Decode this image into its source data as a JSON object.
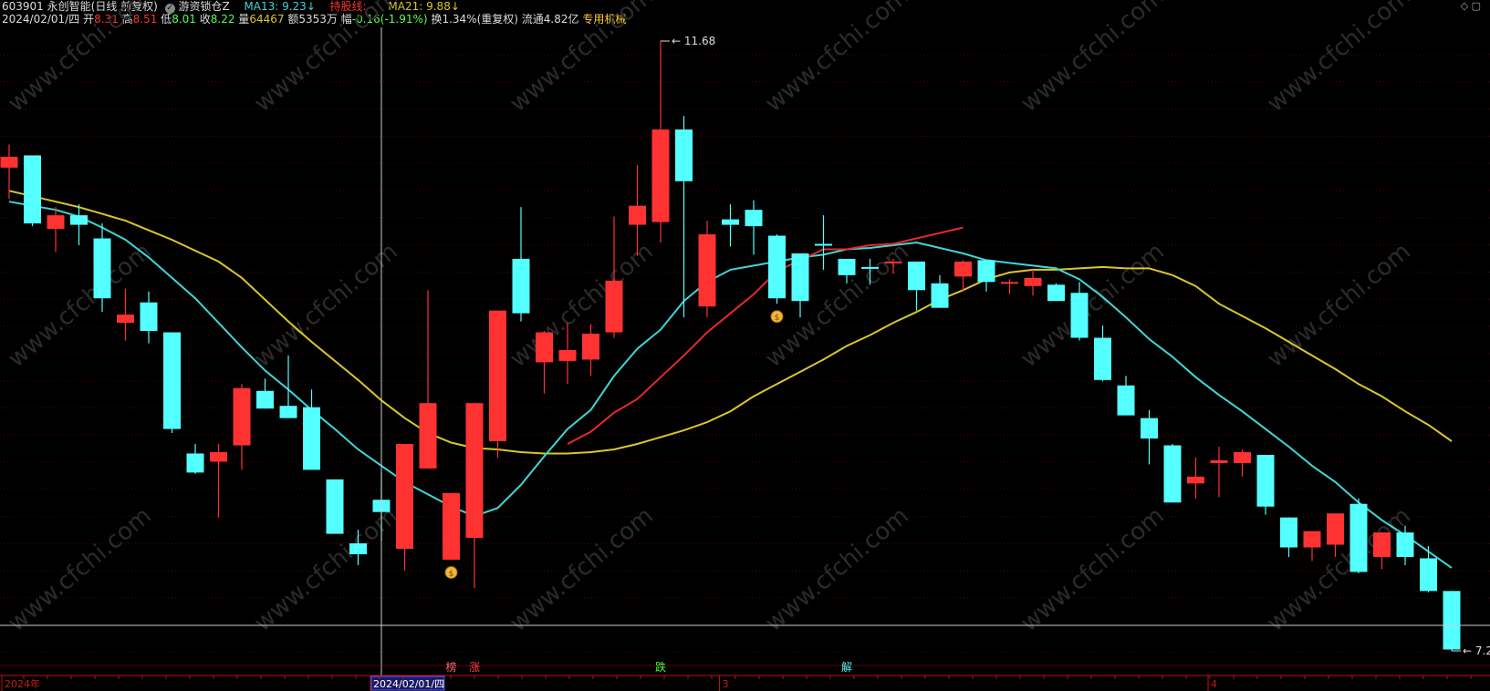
{
  "header": {
    "code": "603901",
    "name": "永创智能",
    "period": "(日线 前复权)",
    "indicator_name": "游资锁仓Z",
    "ma13_label": "MA13:",
    "ma13_value": "9.23",
    "ma13_arrow": "↓",
    "hold_label": "持股线:",
    "hold_value": "-",
    "ma21_label": "MA21:",
    "ma21_value": "9.88",
    "ma21_arrow": "↓",
    "date": "2024/02/01/四",
    "open_label": "开",
    "open_value": "8.31",
    "high_label": "高",
    "high_value": "8.51",
    "low_label": "低",
    "low_value": "8.01",
    "close_label": "收",
    "close_value": "8.22",
    "volume_label": "量",
    "volume_value": "64467",
    "amount_label": "额",
    "amount_value": "5353万",
    "change_label": "幅",
    "change_value": "-0.16(-1.91%)",
    "turnover_label": "换",
    "turnover_value": "1.34%(重复权)",
    "float_label": "流通",
    "float_value": "4.82亿",
    "sector": "专用机械"
  },
  "icons": {
    "indicator": "check-circle-icon",
    "top_right": "diamond-icon"
  },
  "colors": {
    "up": "#ff3232",
    "down": "#54ffff",
    "ma13": "#3fd6d6",
    "ma21": "#d9c72c",
    "hold": "#e8292c",
    "grid": "#5a0000",
    "axis": "#c01010"
  },
  "chart_data": {
    "type": "candlestick",
    "title": "",
    "ylim": [
      7.0,
      12.0
    ],
    "candles": [
      {
        "o": 10.75,
        "h": 10.92,
        "l": 10.52,
        "c": 10.83
      },
      {
        "o": 10.84,
        "h": 10.84,
        "l": 10.32,
        "c": 10.34
      },
      {
        "o": 10.3,
        "h": 10.46,
        "l": 10.13,
        "c": 10.4
      },
      {
        "o": 10.4,
        "h": 10.48,
        "l": 10.18,
        "c": 10.33
      },
      {
        "o": 10.23,
        "h": 10.34,
        "l": 9.69,
        "c": 9.79
      },
      {
        "o": 9.61,
        "h": 9.86,
        "l": 9.48,
        "c": 9.67
      },
      {
        "o": 9.76,
        "h": 9.84,
        "l": 9.46,
        "c": 9.55
      },
      {
        "o": 9.54,
        "h": 9.54,
        "l": 8.8,
        "c": 8.83
      },
      {
        "o": 8.65,
        "h": 8.72,
        "l": 8.5,
        "c": 8.51
      },
      {
        "o": 8.59,
        "h": 8.72,
        "l": 8.18,
        "c": 8.66
      },
      {
        "o": 8.71,
        "h": 9.16,
        "l": 8.53,
        "c": 9.13
      },
      {
        "o": 9.11,
        "h": 9.2,
        "l": 8.98,
        "c": 8.98
      },
      {
        "o": 9.0,
        "h": 9.37,
        "l": 8.91,
        "c": 8.91
      },
      {
        "o": 8.99,
        "h": 9.12,
        "l": 8.53,
        "c": 8.53
      },
      {
        "o": 8.46,
        "h": 8.46,
        "l": 8.07,
        "c": 8.06
      },
      {
        "o": 7.99,
        "h": 8.09,
        "l": 7.83,
        "c": 7.91
      },
      {
        "o": 8.31,
        "h": 8.51,
        "l": 8.01,
        "c": 8.22
      },
      {
        "o": 7.95,
        "h": 8.72,
        "l": 7.79,
        "c": 8.72
      },
      {
        "o": 8.54,
        "h": 9.85,
        "l": 8.54,
        "c": 9.02
      },
      {
        "o": 7.87,
        "h": 8.36,
        "l": 7.87,
        "c": 8.36
      },
      {
        "o": 8.03,
        "h": 9.02,
        "l": 7.66,
        "c": 9.02
      },
      {
        "o": 8.74,
        "h": 9.7,
        "l": 8.62,
        "c": 9.7
      },
      {
        "o": 10.08,
        "h": 10.46,
        "l": 9.62,
        "c": 9.68
      },
      {
        "o": 9.32,
        "h": 9.55,
        "l": 9.09,
        "c": 9.54
      },
      {
        "o": 9.33,
        "h": 9.61,
        "l": 9.16,
        "c": 9.41
      },
      {
        "o": 9.34,
        "h": 9.6,
        "l": 9.22,
        "c": 9.53
      },
      {
        "o": 9.54,
        "h": 10.39,
        "l": 9.5,
        "c": 9.92
      },
      {
        "o": 10.33,
        "h": 10.77,
        "l": 10.1,
        "c": 10.47
      },
      {
        "o": 10.35,
        "h": 11.68,
        "l": 10.2,
        "c": 11.03
      },
      {
        "o": 11.03,
        "h": 11.13,
        "l": 9.65,
        "c": 10.65
      },
      {
        "o": 9.73,
        "h": 10.36,
        "l": 9.65,
        "c": 10.26
      },
      {
        "o": 10.37,
        "h": 10.48,
        "l": 10.17,
        "c": 10.33
      },
      {
        "o": 10.44,
        "h": 10.51,
        "l": 10.11,
        "c": 10.32
      },
      {
        "o": 10.25,
        "h": 10.26,
        "l": 9.75,
        "c": 9.79
      },
      {
        "o": 10.12,
        "h": 10.12,
        "l": 9.65,
        "c": 9.77
      },
      {
        "o": 10.19,
        "h": 10.4,
        "l": 10.0,
        "c": 10.18
      },
      {
        "o": 10.08,
        "h": 10.08,
        "l": 9.9,
        "c": 9.96
      },
      {
        "o": 10.02,
        "h": 10.08,
        "l": 9.89,
        "c": 10.01
      },
      {
        "o": 10.05,
        "h": 10.08,
        "l": 9.97,
        "c": 10.06
      },
      {
        "o": 10.06,
        "h": 10.06,
        "l": 9.7,
        "c": 9.85
      },
      {
        "o": 9.9,
        "h": 9.96,
        "l": 9.72,
        "c": 9.72
      },
      {
        "o": 9.95,
        "h": 10.07,
        "l": 9.84,
        "c": 10.06
      },
      {
        "o": 10.07,
        "h": 10.07,
        "l": 9.84,
        "c": 9.91
      },
      {
        "o": 9.91,
        "h": 9.93,
        "l": 9.82,
        "c": 9.91
      },
      {
        "o": 9.88,
        "h": 10.0,
        "l": 9.81,
        "c": 9.94
      },
      {
        "o": 9.89,
        "h": 9.9,
        "l": 9.77,
        "c": 9.77
      },
      {
        "o": 9.83,
        "h": 9.91,
        "l": 9.48,
        "c": 9.5
      },
      {
        "o": 9.5,
        "h": 9.59,
        "l": 9.18,
        "c": 9.19
      },
      {
        "o": 9.15,
        "h": 9.22,
        "l": 8.93,
        "c": 8.93
      },
      {
        "o": 8.91,
        "h": 8.97,
        "l": 8.57,
        "c": 8.76
      },
      {
        "o": 8.71,
        "h": 8.72,
        "l": 8.29,
        "c": 8.29
      },
      {
        "o": 8.43,
        "h": 8.62,
        "l": 8.32,
        "c": 8.48
      },
      {
        "o": 8.58,
        "h": 8.7,
        "l": 8.33,
        "c": 8.6
      },
      {
        "o": 8.58,
        "h": 8.68,
        "l": 8.48,
        "c": 8.66
      },
      {
        "o": 8.64,
        "h": 8.64,
        "l": 8.2,
        "c": 8.26
      },
      {
        "o": 8.18,
        "h": 8.18,
        "l": 7.89,
        "c": 7.96
      },
      {
        "o": 7.96,
        "h": 8.03,
        "l": 7.86,
        "c": 8.08
      },
      {
        "o": 7.98,
        "h": 8.1,
        "l": 7.89,
        "c": 8.21
      },
      {
        "o": 8.28,
        "h": 8.32,
        "l": 7.77,
        "c": 7.78
      },
      {
        "o": 7.89,
        "h": 8.07,
        "l": 7.8,
        "c": 8.07
      },
      {
        "o": 8.07,
        "h": 8.12,
        "l": 7.83,
        "c": 7.89
      },
      {
        "o": 7.88,
        "h": 7.97,
        "l": 7.63,
        "c": 7.64
      },
      {
        "o": 7.64,
        "h": 7.64,
        "l": 7.2,
        "c": 7.21
      }
    ],
    "ma13": [
      10.5,
      10.47,
      10.44,
      10.39,
      10.31,
      10.22,
      10.09,
      9.94,
      9.79,
      9.61,
      9.43,
      9.26,
      9.12,
      8.97,
      8.83,
      8.68,
      8.56,
      8.44,
      8.35,
      8.26,
      8.19,
      8.25,
      8.42,
      8.63,
      8.83,
      8.97,
      9.22,
      9.42,
      9.56,
      9.77,
      9.91,
      10.0,
      10.03,
      10.06,
      10.09,
      10.11,
      10.15,
      10.16,
      10.18,
      10.2,
      10.16,
      10.12,
      10.07,
      10.05,
      10.03,
      10.01,
      9.93,
      9.8,
      9.65,
      9.49,
      9.36,
      9.21,
      9.08,
      8.96,
      8.83,
      8.7,
      8.56,
      8.44,
      8.29,
      8.16,
      8.05,
      7.93,
      7.81
    ],
    "ma21": [
      10.58,
      10.54,
      10.5,
      10.46,
      10.41,
      10.36,
      10.29,
      10.22,
      10.14,
      10.06,
      9.94,
      9.78,
      9.62,
      9.47,
      9.33,
      9.19,
      9.04,
      8.91,
      8.8,
      8.73,
      8.69,
      8.68,
      8.66,
      8.65,
      8.65,
      8.66,
      8.68,
      8.72,
      8.77,
      8.82,
      8.88,
      8.96,
      9.07,
      9.16,
      9.25,
      9.34,
      9.44,
      9.52,
      9.61,
      9.69,
      9.78,
      9.85,
      9.93,
      9.98,
      10.0,
      10.0,
      10.01,
      10.02,
      10.01,
      10.01,
      9.96,
      9.88,
      9.75,
      9.66,
      9.57,
      9.47,
      9.37,
      9.27,
      9.16,
      9.07,
      8.96,
      8.86,
      8.74
    ],
    "hold_line": [
      null,
      null,
      null,
      null,
      null,
      null,
      null,
      null,
      null,
      null,
      null,
      null,
      null,
      null,
      null,
      null,
      null,
      null,
      null,
      null,
      null,
      null,
      null,
      null,
      8.72,
      8.81,
      8.95,
      9.05,
      9.21,
      9.37,
      9.54,
      9.68,
      9.82,
      9.99,
      10.07,
      10.15,
      10.15,
      10.18,
      10.19,
      10.23,
      10.27,
      10.31,
      null,
      null,
      null,
      null,
      null,
      null,
      null,
      null,
      null,
      null,
      null,
      null,
      null,
      null,
      null,
      null,
      null,
      null,
      null,
      null,
      null
    ],
    "high_mark": {
      "index": 28,
      "value": "11.68"
    },
    "low_mark": {
      "index": 62,
      "value": "7.20"
    },
    "crosshair": {
      "index": 16
    },
    "signals": [
      {
        "index": 19,
        "text": "榜",
        "color": "#ff7070"
      },
      {
        "index": 20,
        "text": "涨",
        "color": "#ff4040"
      },
      {
        "index": 28,
        "text": "跌",
        "color": "#40ff40"
      },
      {
        "index": 36,
        "text": "解",
        "color": "#54ffff"
      }
    ],
    "money_bags": [
      19,
      33
    ],
    "x_axis": [
      {
        "index": 0,
        "label": "2024年"
      },
      {
        "index": 16,
        "label": "2024/02/01/四",
        "highlight": true
      },
      {
        "index": 31,
        "label": "3"
      },
      {
        "index": 52,
        "label": "4"
      }
    ],
    "watermark": "www.cfchi.com"
  }
}
